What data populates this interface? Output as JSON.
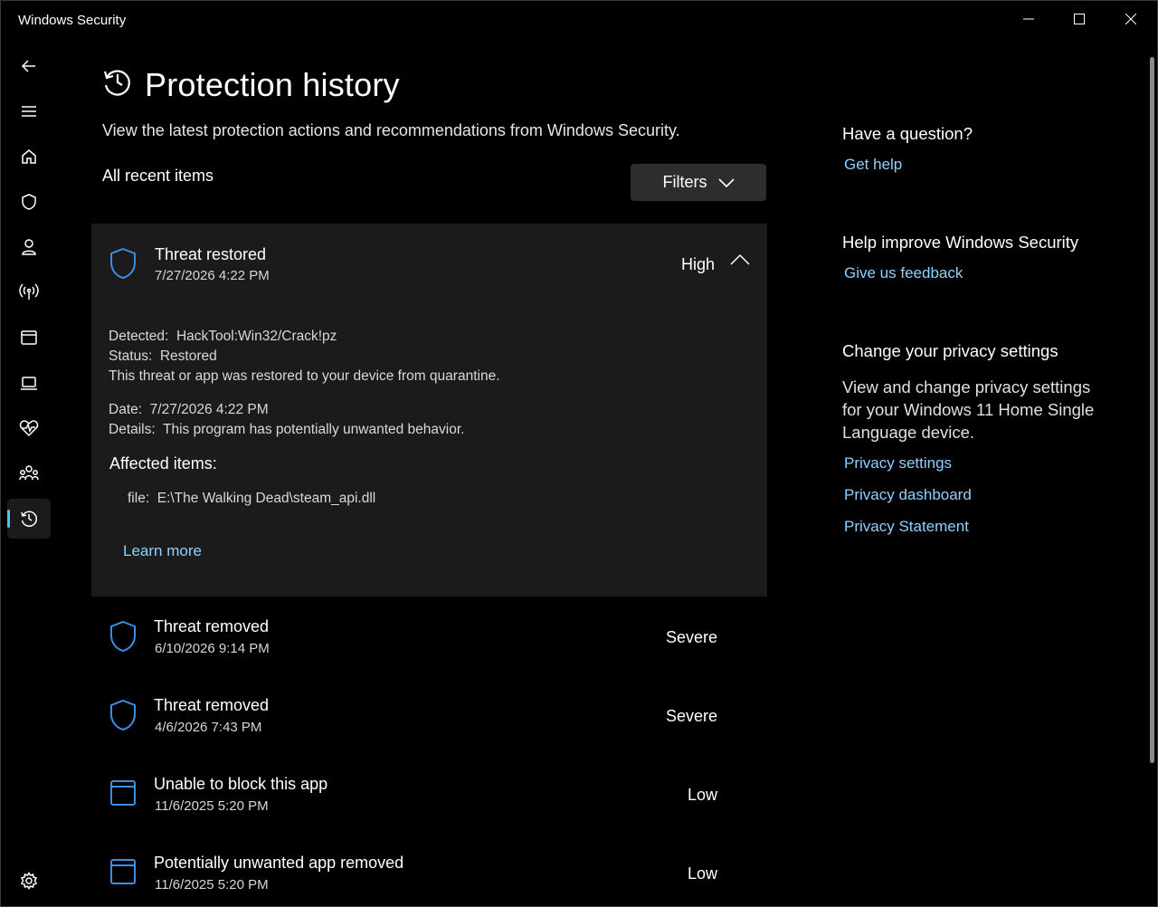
{
  "app": {
    "title": "Windows Security"
  },
  "nav": {
    "items": [
      {
        "icon": "back-arrow-icon"
      },
      {
        "icon": "hamburger-menu-icon"
      },
      {
        "icon": "home-icon"
      },
      {
        "icon": "shield-icon"
      },
      {
        "icon": "person-icon"
      },
      {
        "icon": "wireless-antenna-icon"
      },
      {
        "icon": "app-browser-icon"
      },
      {
        "icon": "laptop-icon"
      },
      {
        "icon": "heartbeat-icon"
      },
      {
        "icon": "family-icon"
      },
      {
        "icon": "history-icon",
        "active": true
      },
      {
        "icon": "settings-gear-icon"
      }
    ]
  },
  "main": {
    "title": "Protection history",
    "subtitle": "View the latest protection actions and recommendations from Windows Security.",
    "section_label": "All recent items",
    "filters_label": "Filters",
    "expanded_item": {
      "title": "Threat restored",
      "date": "7/27/2026 4:22 PM",
      "severity": "High",
      "detected": "Detected:  HackTool:Win32/Crack!pz",
      "status": "Status:  Restored",
      "status_note": "This threat or app was restored to your device from quarantine.",
      "date_line": "Date:  7/27/2026 4:22 PM",
      "details": "Details:  This program has potentially unwanted behavior.",
      "affected_label": "Affected items:",
      "file": "file:  E:\\The Walking Dead\\steam_api.dll",
      "learn_more": "Learn more"
    },
    "items": [
      {
        "title": "Threat removed",
        "date": "6/10/2026 9:14 PM",
        "severity": "Severe",
        "icon": "shield-icon"
      },
      {
        "title": "Threat removed",
        "date": "4/6/2026 7:43 PM",
        "severity": "Severe",
        "icon": "shield-icon"
      },
      {
        "title": "Unable to block this app",
        "date": "11/6/2025 5:20 PM",
        "severity": "Low",
        "icon": "app-window-icon"
      },
      {
        "title": "Potentially unwanted app removed",
        "date": "11/6/2025 5:20 PM",
        "severity": "Low",
        "icon": "app-window-icon"
      }
    ]
  },
  "side": {
    "question_heading": "Have a question?",
    "get_help": "Get help",
    "improve_heading": "Help improve Windows Security",
    "feedback": "Give us feedback",
    "privacy_heading": "Change your privacy settings",
    "privacy_text": "View and change privacy settings for your Windows 11 Home Single Language device.",
    "privacy_settings": "Privacy settings",
    "privacy_dashboard": "Privacy dashboard",
    "privacy_statement": "Privacy Statement"
  },
  "colors": {
    "accent_link": "#8fd0ff",
    "icon_blue": "#3a8fe0",
    "nav_indicator": "#4cc2ff",
    "card_bg": "#1b1b1b"
  }
}
